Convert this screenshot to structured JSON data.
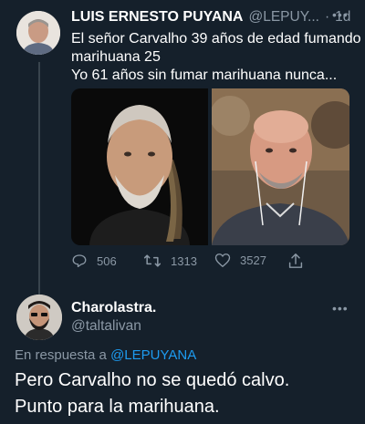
{
  "tweet": {
    "author_name": "LUIS ERNESTO PUYANA",
    "author_handle": "@LEPUY...",
    "time_sep": "·",
    "time": "1d",
    "text_line1": "El señor Carvalho 39 años de edad fumando",
    "text_line2": "marihuana 25",
    "text_line3": "Yo 61 años sin fumar marihuana nunca...",
    "replies": "506",
    "retweets": "1313",
    "likes": "3527"
  },
  "reply": {
    "author_name": "Charolastra.",
    "author_handle": "@taltalivan",
    "replying_prefix": "En respuesta a",
    "replying_to": "@LEPUYANA",
    "text_line1": "Pero Carvalho no se quedó calvo.",
    "text_line2": "Punto para la marihuana."
  },
  "colors": {
    "background": "#15202b",
    "muted": "#8b98a5",
    "link": "#1d9bf0"
  },
  "icons": [
    "more-icon",
    "reply-icon",
    "retweet-icon",
    "like-icon",
    "share-icon"
  ]
}
